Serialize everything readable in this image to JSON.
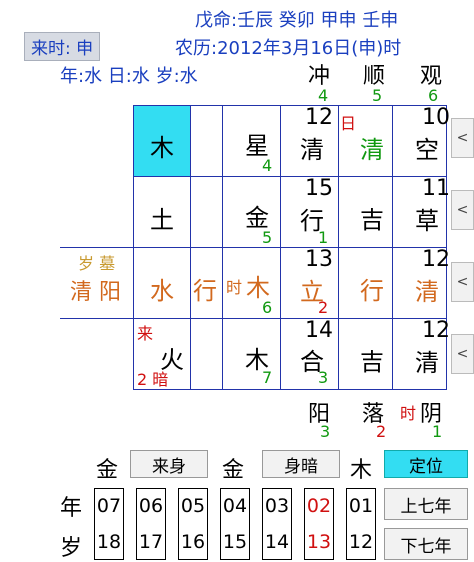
{
  "header": {
    "line1": "戊命:壬辰 癸卯 甲申 壬申",
    "line2": "农历:2012年3月16日(申)时",
    "line3": "年:水 日:水 岁:水",
    "badge": "来时: 申"
  },
  "top_labels": {
    "col1": "观",
    "col1_num": "6",
    "col2": "顺",
    "col2_num": "5",
    "col3": "冲",
    "col3_num": "4"
  },
  "grid": {
    "rows": [
      {
        "nav": "<",
        "c1": {
          "num": "10",
          "char": "空"
        },
        "c2": {
          "char": "清",
          "mark": "日"
        },
        "c3": {
          "num": "12",
          "char": "清"
        },
        "c4": {
          "char": "星",
          "sub": "4"
        },
        "c5": {
          "char": ""
        },
        "c6": {
          "char": "木"
        }
      },
      {
        "nav": "<",
        "c1": {
          "num": "11",
          "char": "草"
        },
        "c2": {
          "char": "吉"
        },
        "c3": {
          "num": "15",
          "char": "行",
          "sub": "1"
        },
        "c4": {
          "char": "金",
          "sub": "5"
        },
        "c5": {
          "char": ""
        },
        "c6": {
          "char": "土"
        }
      },
      {
        "nav": "<",
        "c1": {
          "num": "12",
          "char": "清"
        },
        "c2": {
          "char": "行"
        },
        "c3": {
          "num": "13",
          "char": "立",
          "sub": "2"
        },
        "c4": {
          "char": "木",
          "mark": "时",
          "sub": "6"
        },
        "c5": {
          "char": "行"
        },
        "c6": {
          "char": "水"
        },
        "c7": {
          "top": "岁 墓",
          "char": "清 阳"
        }
      },
      {
        "nav": "<",
        "c1": {
          "num": "12",
          "char": "清"
        },
        "c2": {
          "char": "吉"
        },
        "c3": {
          "num": "14",
          "char": "合",
          "sub": "3"
        },
        "c4": {
          "char": "木",
          "sub": "7"
        },
        "c5": {
          "char": ""
        },
        "c6": {
          "char": "火",
          "mark": "来",
          "sub": "2 暗"
        }
      }
    ]
  },
  "bottom_labels": {
    "col1": "阴",
    "col1_mark": "时",
    "col1_num": "1",
    "col2": "落",
    "col2_num": "2",
    "col3": "阳",
    "col3_num": "3"
  },
  "controls": {
    "dingwei": "定位",
    "mu": "木",
    "shen_an": "身暗",
    "jin1": "金",
    "lai_shen": "来身",
    "jin2": "金"
  },
  "year_row": {
    "label_top": "年",
    "label_bottom": "岁",
    "up_button": "上七年",
    "down_button": "下七年",
    "boxes": [
      {
        "top": "01",
        "bottom": "12"
      },
      {
        "top": "02",
        "bottom": "13"
      },
      {
        "top": "03",
        "bottom": "14"
      },
      {
        "top": "04",
        "bottom": "15"
      },
      {
        "top": "05",
        "bottom": "16"
      },
      {
        "top": "06",
        "bottom": "17"
      },
      {
        "top": "07",
        "bottom": "18"
      }
    ]
  },
  "colors": {
    "accent_blue": "#1a3fbf",
    "highlight_cyan": "#33ddf2",
    "green": "#119911",
    "red": "#d01010",
    "orange": "#d2691e"
  }
}
